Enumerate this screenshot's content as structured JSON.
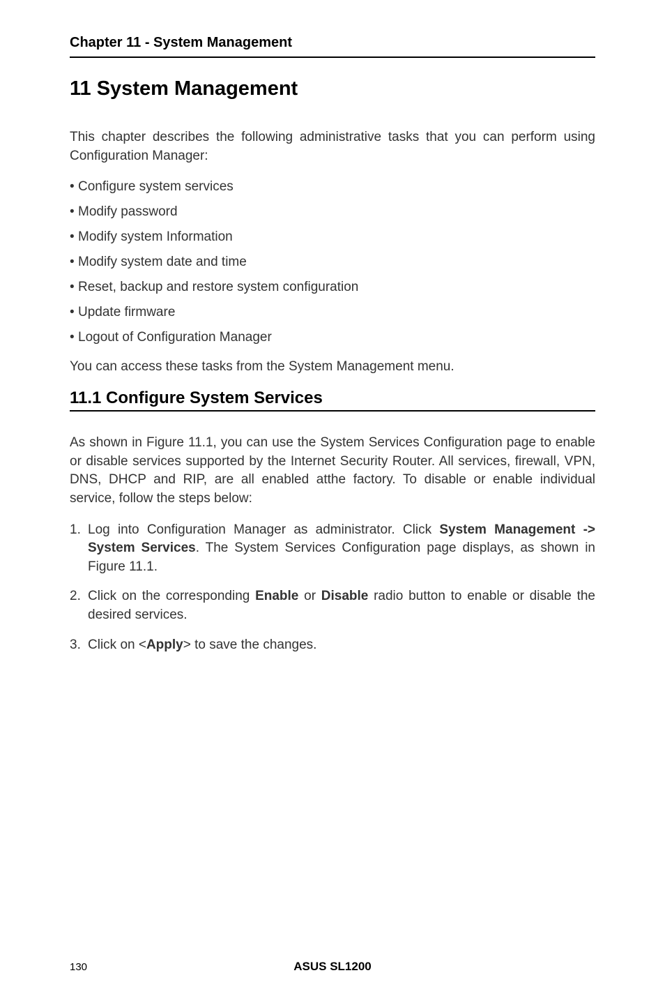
{
  "header": {
    "chapter_header": "Chapter 11 - System Management"
  },
  "title": "11 System Management",
  "intro": "This chapter describes the following administrative tasks that you can perform using Configuration Manager:",
  "bullets": [
    "Configure system services",
    "Modify password",
    "Modify system Information",
    "Modify system date and time",
    "Reset, backup and restore system configuration",
    "Update firmware",
    "Logout of Configuration Manager"
  ],
  "access_note": "You can access these tasks from the System Management menu.",
  "section": {
    "title": "11.1 Configure System Services",
    "body": "As shown in Figure 11.1, you can use the System Services Configuration page to enable or disable services supported by the Internet Security Router. All services, firewall, VPN, DNS, DHCP and RIP, are all enabled atthe factory. To disable or enable individual service, follow the steps below:",
    "steps": [
      {
        "pre1": "Log into Configuration Manager as administrator. Click ",
        "b1": "System Management -> System Services",
        "post1": ". The System Services Configuration page displays, as shown in Figure 11.1."
      },
      {
        "pre1": "Click on the corresponding ",
        "b1": "Enable",
        "mid1": " or ",
        "b2": "Disable",
        "post1": " radio button to enable or disable the desired services."
      },
      {
        "pre1": "Click on <",
        "b1": "Apply",
        "post1": "> to save the changes."
      }
    ]
  },
  "footer": {
    "page": "130",
    "title": "ASUS SL1200"
  }
}
